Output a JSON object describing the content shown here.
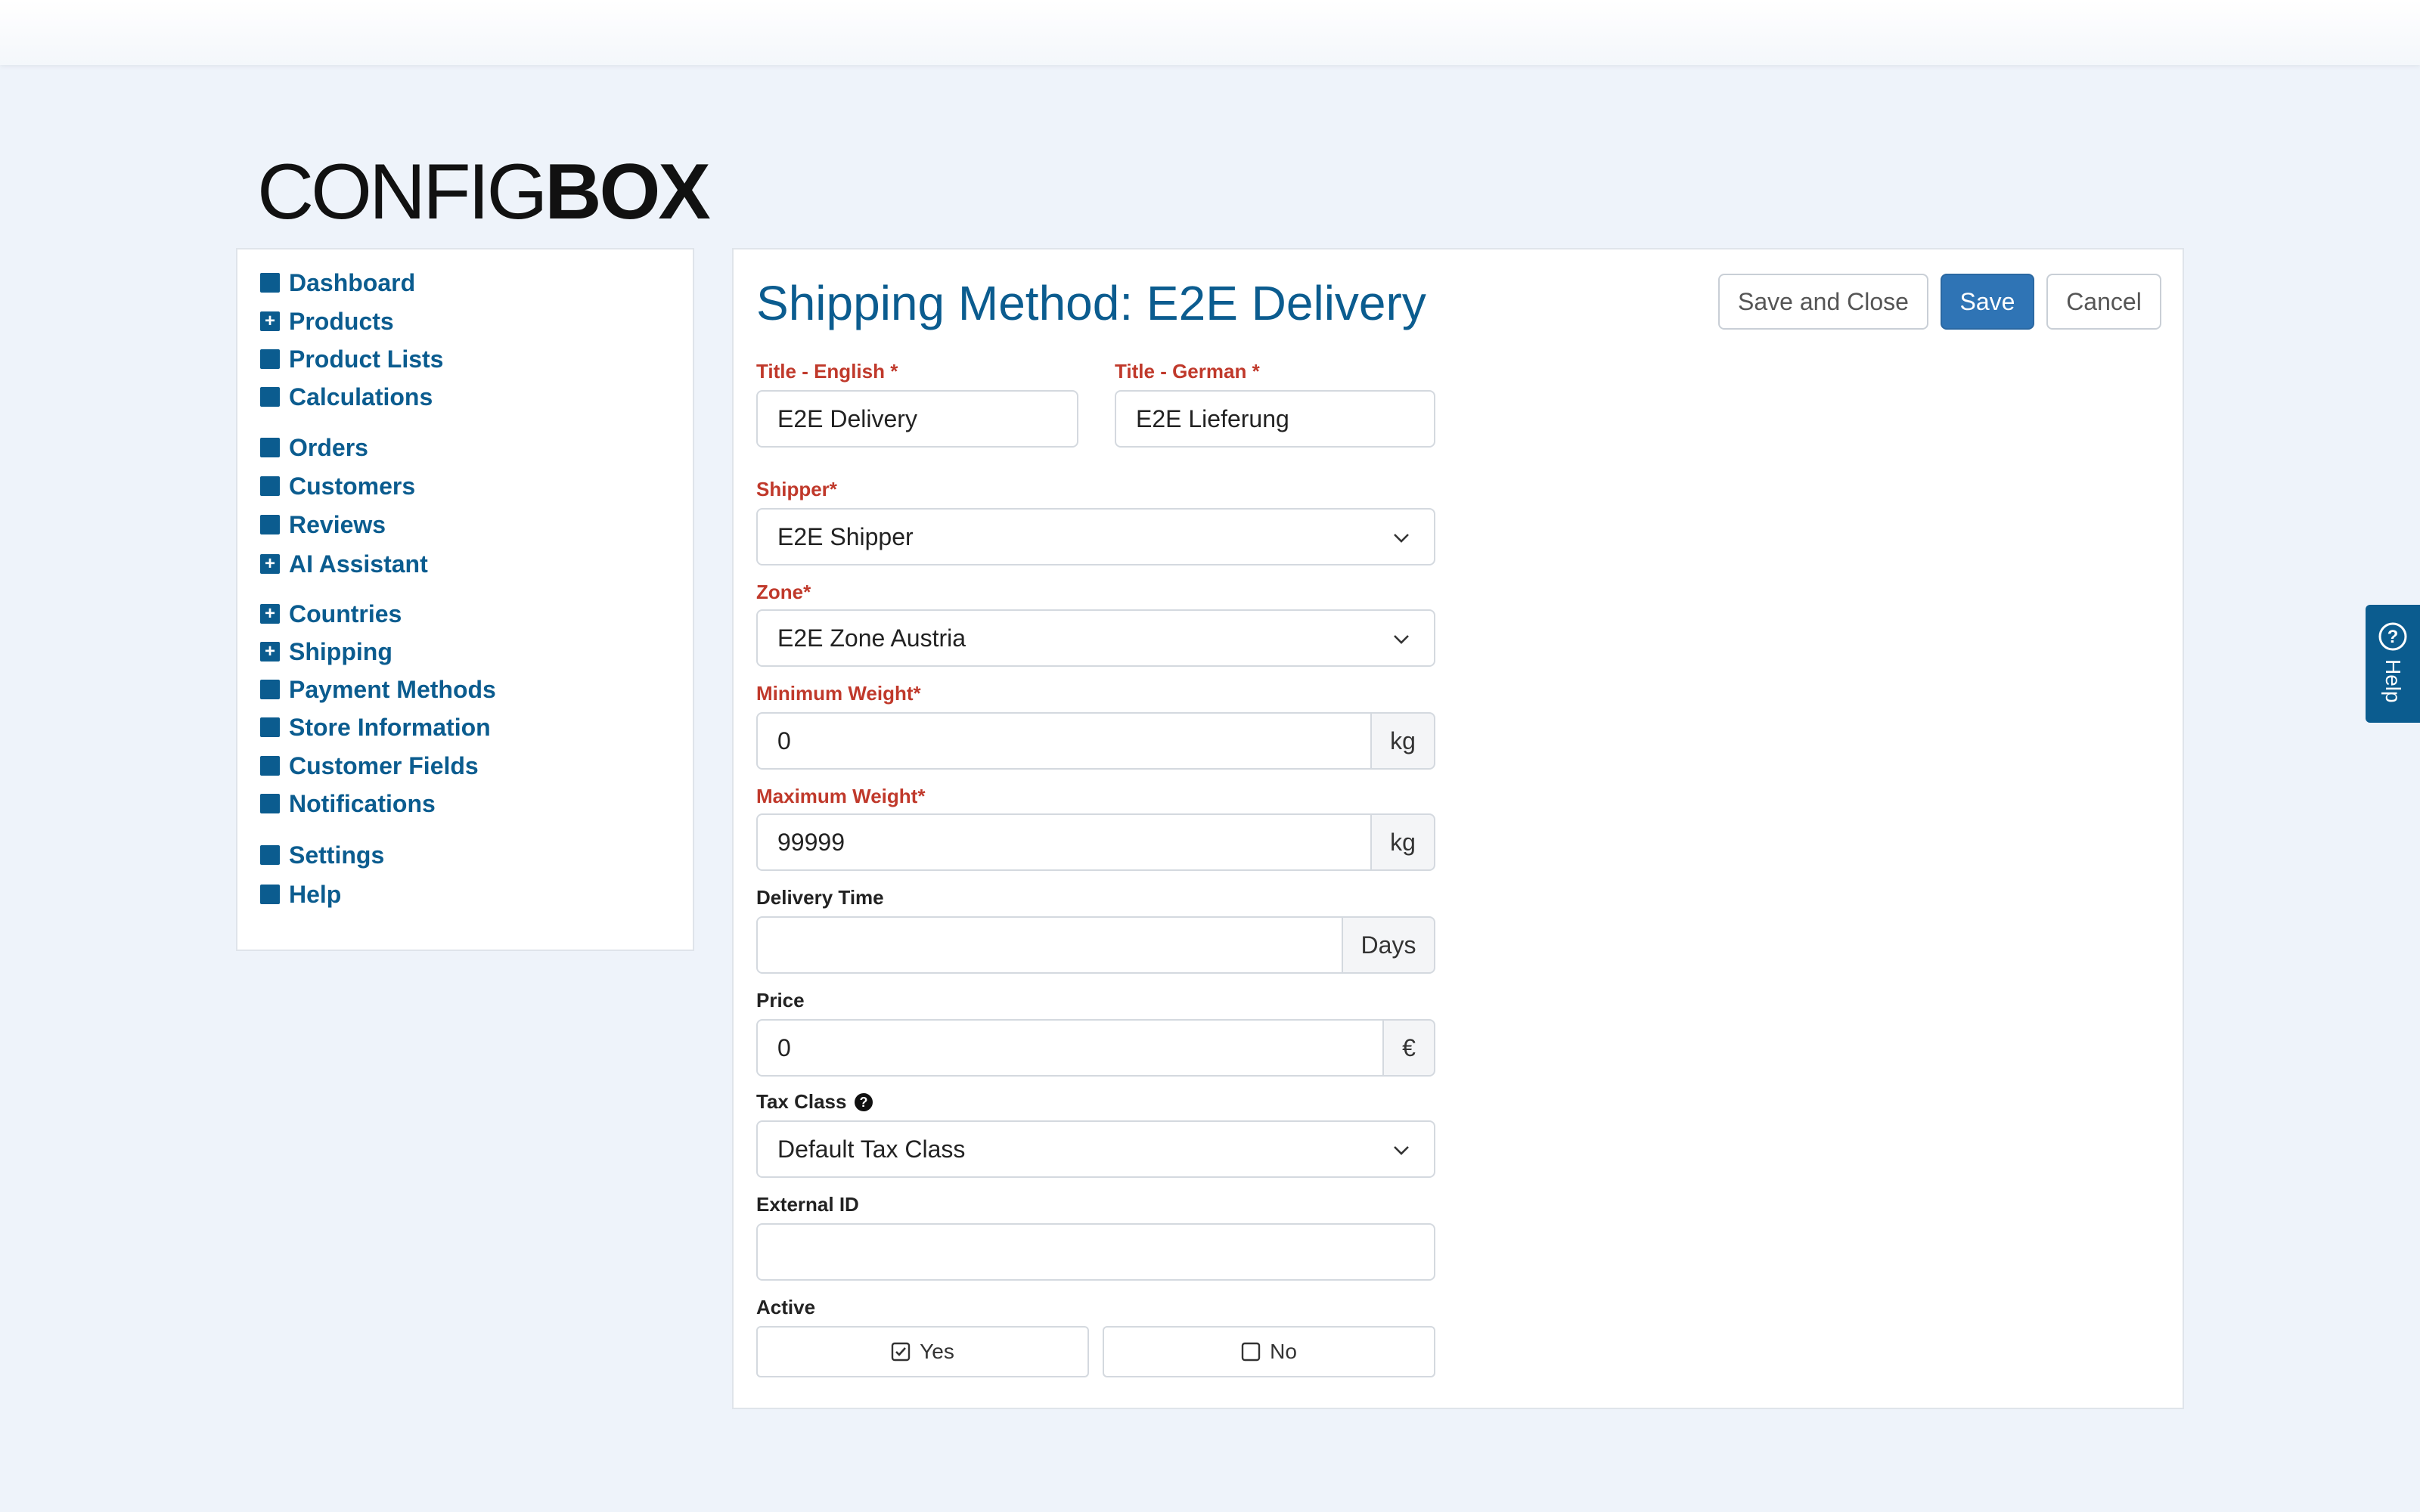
{
  "logo": {
    "light": "CONFIG",
    "bold": "BOX"
  },
  "sidebar": {
    "items": [
      {
        "label": "Dashboard",
        "icon": "square-icon"
      },
      {
        "label": "Products",
        "icon": "plus-square-icon"
      },
      {
        "label": "Product Lists",
        "icon": "square-icon"
      },
      {
        "label": "Calculations",
        "icon": "square-icon"
      },
      {
        "label": "Orders",
        "icon": "square-icon"
      },
      {
        "label": "Customers",
        "icon": "square-icon"
      },
      {
        "label": "Reviews",
        "icon": "square-icon"
      },
      {
        "label": "AI Assistant",
        "icon": "plus-square-icon"
      },
      {
        "label": "Countries",
        "icon": "plus-square-icon"
      },
      {
        "label": "Shipping",
        "icon": "plus-square-icon"
      },
      {
        "label": "Payment Methods",
        "icon": "square-icon"
      },
      {
        "label": "Store Information",
        "icon": "square-icon"
      },
      {
        "label": "Customer Fields",
        "icon": "square-icon"
      },
      {
        "label": "Notifications",
        "icon": "square-icon"
      },
      {
        "label": "Settings",
        "icon": "square-icon"
      },
      {
        "label": "Help",
        "icon": "square-icon"
      }
    ]
  },
  "main": {
    "title": "Shipping Method: E2E Delivery",
    "buttons": {
      "save_close": "Save and Close",
      "save": "Save",
      "cancel": "Cancel"
    }
  },
  "form": {
    "title_en": {
      "label": "Title - English *",
      "value": "E2E Delivery"
    },
    "title_de": {
      "label": "Title - German *",
      "value": "E2E Lieferung"
    },
    "shipper": {
      "label": "Shipper*",
      "value": "E2E Shipper"
    },
    "zone": {
      "label": "Zone*",
      "value": "E2E Zone Austria"
    },
    "min_weight": {
      "label": "Minimum Weight*",
      "value": "0",
      "unit": "kg"
    },
    "max_weight": {
      "label": "Maximum Weight*",
      "value": "99999",
      "unit": "kg"
    },
    "delivery_time": {
      "label": "Delivery Time",
      "value": "",
      "unit": "Days"
    },
    "price": {
      "label": "Price",
      "value": "0",
      "unit": "€"
    },
    "tax_class": {
      "label": "Tax Class",
      "value": "Default Tax Class"
    },
    "external_id": {
      "label": "External ID",
      "value": ""
    },
    "active": {
      "label": "Active",
      "yes": "Yes",
      "no": "No",
      "selected": "yes"
    }
  },
  "help_tab": {
    "label": "Help"
  },
  "colors": {
    "brand": "#0b5c8f",
    "primary_button": "#2f74b5",
    "required": "#c0392b",
    "background": "#eef3fa"
  }
}
